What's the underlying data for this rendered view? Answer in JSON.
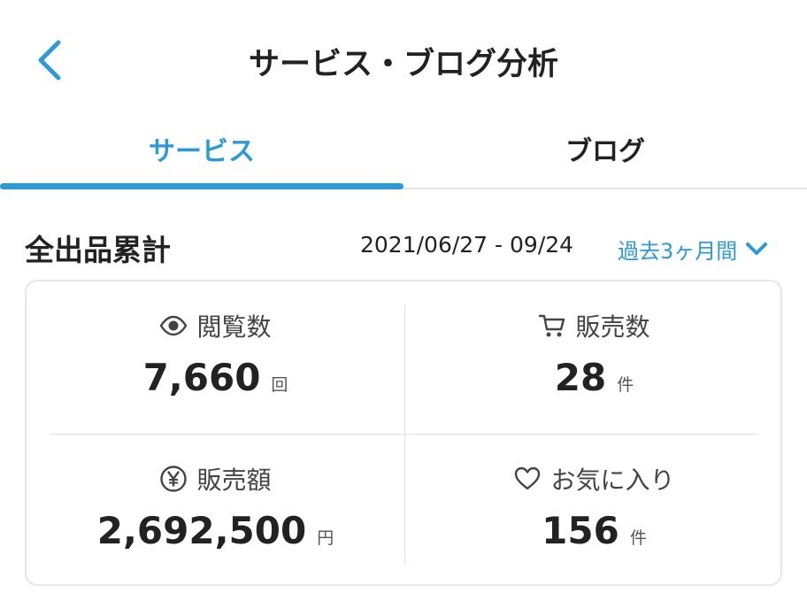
{
  "header": {
    "title": "サービス・ブログ分析"
  },
  "tabs": [
    {
      "label": "サービス",
      "active": true
    },
    {
      "label": "ブログ",
      "active": false
    }
  ],
  "summary": {
    "title": "全出品累計",
    "date_range": "2021/06/27 - 09/24",
    "period": "過去3ヶ月間"
  },
  "stats": {
    "views": {
      "label": "閲覧数",
      "value": "7,660",
      "unit": "回",
      "icon": "eye-icon"
    },
    "sales_count": {
      "label": "販売数",
      "value": "28",
      "unit": "件",
      "icon": "cart-icon"
    },
    "sales_amount": {
      "label": "販売額",
      "value": "2,692,500",
      "unit": "円",
      "icon": "yen-icon"
    },
    "favorites": {
      "label": "お気に入り",
      "value": "156",
      "unit": "件",
      "icon": "heart-icon"
    }
  },
  "colors": {
    "accent": "#2b9ad7",
    "text": "#222222",
    "divider": "#e2e2e2"
  }
}
